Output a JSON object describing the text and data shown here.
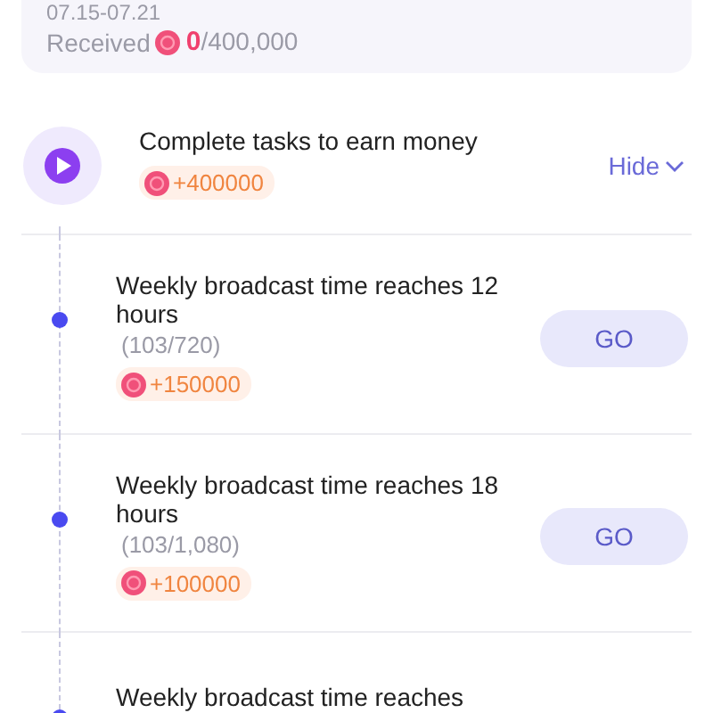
{
  "period_card": {
    "date_range": "07.15-07.21",
    "received_label": "Received",
    "received_value": "0",
    "received_total": "/400,000"
  },
  "task_group": {
    "title": "Complete tasks to earn money",
    "reward": "+400000",
    "toggle": "Hide",
    "expanded": true
  },
  "tasks": [
    {
      "title": "Weekly broadcast time reaches 12 hours",
      "progress": "(103/720)",
      "reward": "+150000",
      "action": "GO"
    },
    {
      "title": "Weekly broadcast time reaches 18 hours",
      "progress": "(103/1,080)",
      "reward": "+100000",
      "action": "GO"
    },
    {
      "title": "Weekly broadcast time reaches"
    }
  ]
}
